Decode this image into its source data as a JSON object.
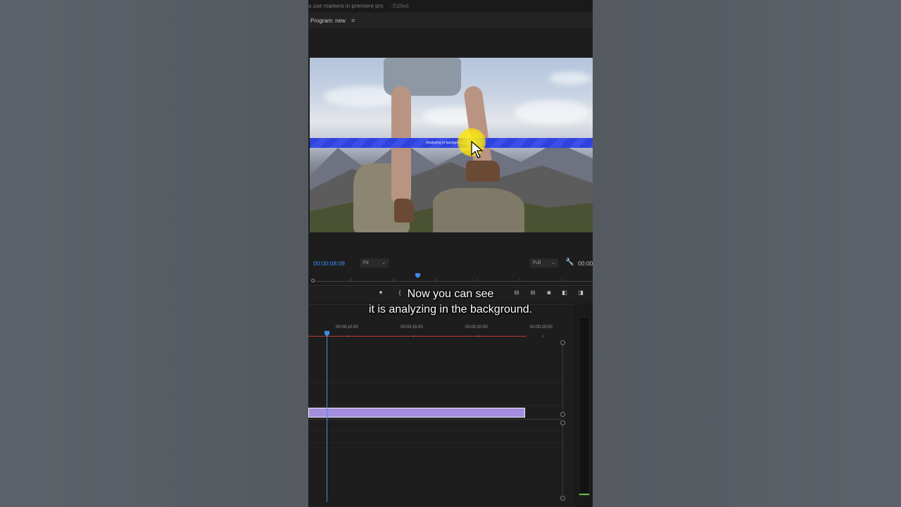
{
  "window": {
    "title": "o use markers in premiere pro",
    "status": "- Edited"
  },
  "program_monitor": {
    "title": "Program: new",
    "menu_icon": "hamburger-menu-icon",
    "overlay_text": "Analyzing in background (1 of 2)",
    "timecode_current": "00:00:08:09",
    "fit_select": "Fit",
    "resolution_select": "Full",
    "timecode_duration": "00:00"
  },
  "timeline": {
    "ruler_labels": [
      "00:00:10:00",
      "00:00:15:00",
      "00:00:20:00",
      "00:00:25:00"
    ]
  },
  "caption": {
    "line1": "Now you can see",
    "line2": "it is analyzing in the background."
  },
  "colors": {
    "accent_blue": "#3f8cf0",
    "clip_purple": "#a58ddd",
    "analyze_bar": "#2f43dc",
    "work_area_red": "#c0392b"
  }
}
